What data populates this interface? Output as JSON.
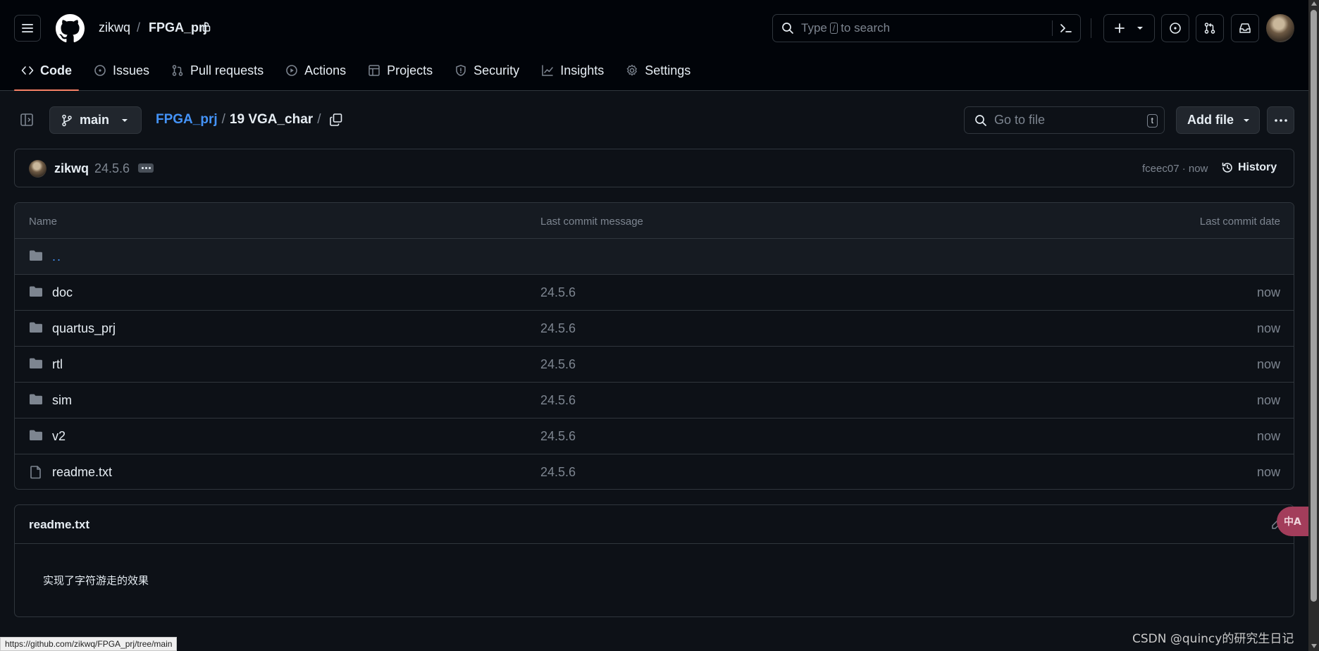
{
  "header": {
    "owner": "zikwq",
    "slash": "/",
    "repo": "FPGA_prj",
    "search": {
      "prefix": "Type",
      "key": "/",
      "suffix": "to search"
    }
  },
  "nav": [
    {
      "label": "Code",
      "icon": "code-icon",
      "active": true
    },
    {
      "label": "Issues",
      "icon": "issue-icon"
    },
    {
      "label": "Pull requests",
      "icon": "pull-request-icon"
    },
    {
      "label": "Actions",
      "icon": "play-icon"
    },
    {
      "label": "Projects",
      "icon": "table-icon"
    },
    {
      "label": "Security",
      "icon": "shield-icon"
    },
    {
      "label": "Insights",
      "icon": "graph-icon"
    },
    {
      "label": "Settings",
      "icon": "gear-icon"
    }
  ],
  "subheader": {
    "branch": "main",
    "breadcrumb": {
      "root": "FPGA_prj",
      "sep": "/",
      "current": "19 VGA_char"
    },
    "goto_placeholder": "Go to file",
    "goto_key": "t",
    "add_file": "Add file"
  },
  "commit": {
    "author": "zikwq",
    "message": "24.5.6",
    "hash_time": "fceec07 · now",
    "history": "History"
  },
  "table": {
    "headers": {
      "name": "Name",
      "message": "Last commit message",
      "date": "Last commit date"
    },
    "parent": "..",
    "rows": [
      {
        "name": "doc",
        "type": "folder",
        "message": "24.5.6",
        "date": "now"
      },
      {
        "name": "quartus_prj",
        "type": "folder",
        "message": "24.5.6",
        "date": "now"
      },
      {
        "name": "rtl",
        "type": "folder",
        "message": "24.5.6",
        "date": "now"
      },
      {
        "name": "sim",
        "type": "folder",
        "message": "24.5.6",
        "date": "now"
      },
      {
        "name": "v2",
        "type": "folder",
        "message": "24.5.6",
        "date": "now"
      },
      {
        "name": "readme.txt",
        "type": "file",
        "message": "24.5.6",
        "date": "now"
      }
    ]
  },
  "readme": {
    "title": "readme.txt",
    "content": "实现了字符游走的效果"
  },
  "translate_label": "中A",
  "status_url": "https://github.com/zikwq/FPGA_prj/tree/main",
  "watermark": "CSDN @quincy的研究生日记",
  "colors": {
    "accent": "#4493f8",
    "tab_underline": "#f78166",
    "background": "#0d1117"
  }
}
